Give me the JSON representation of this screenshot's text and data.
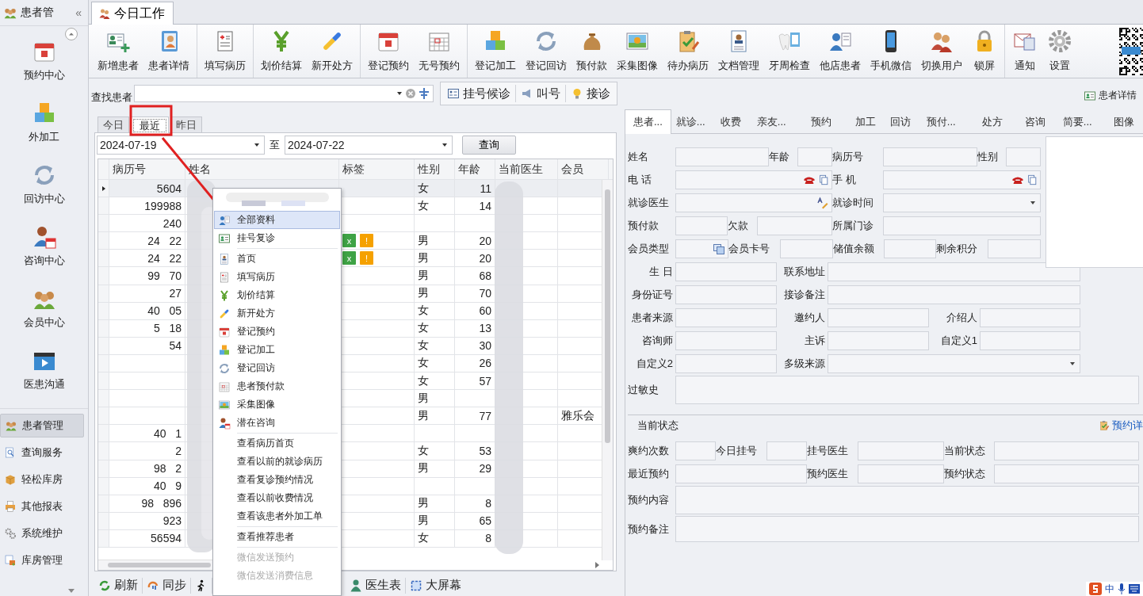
{
  "sidebar": {
    "header": "患者管",
    "collapse": "«",
    "big_items": [
      "预约中心",
      "外加工",
      "回访中心",
      "咨询中心",
      "会员中心",
      "医患沟通"
    ],
    "nav_items": [
      {
        "label": "患者管理",
        "selected": true
      },
      {
        "label": "查询服务",
        "selected": false
      },
      {
        "label": "轻松库房",
        "selected": false
      },
      {
        "label": "其他报表",
        "selected": false
      },
      {
        "label": "系统维护",
        "selected": false
      },
      {
        "label": "库房管理",
        "selected": false
      }
    ]
  },
  "document_tab": {
    "label": "今日工作"
  },
  "toolbar": {
    "groups": [
      [
        "新增患者",
        "患者详情"
      ],
      [
        "填写病历"
      ],
      [
        "划价结算",
        "新开处方"
      ],
      [
        "登记预约",
        "无号预约"
      ],
      [
        "登记加工",
        "登记回访",
        "预付款",
        "采集图像",
        "待办病历",
        "文档管理",
        "牙周检查",
        "他店患者",
        "手机微信",
        "切换用户",
        "锁屏"
      ],
      [
        "通知",
        "设置"
      ]
    ]
  },
  "search": {
    "label": "查找患者",
    "buttons": [
      "挂号候诊",
      "叫号",
      "接诊"
    ]
  },
  "detail_button": "患者详情",
  "period_tabs": [
    {
      "label": "今日",
      "selected": false
    },
    {
      "label": "最近",
      "selected": true
    },
    {
      "label": "昨日",
      "selected": false
    }
  ],
  "date_range": {
    "from": "2024-07-19",
    "separator": "至",
    "to": "2024-07-22",
    "query": "查询"
  },
  "table": {
    "columns": [
      "病历号",
      "姓名",
      "标签",
      "性别",
      "年龄",
      "当前医生",
      "会员"
    ],
    "rows": [
      {
        "selected": true,
        "id": "5604",
        "sex": "女",
        "age": "11"
      },
      {
        "selected": false,
        "id": "199988",
        "sex": "女",
        "age": "14"
      },
      {
        "selected": false,
        "id": "240"
      },
      {
        "selected": false,
        "id": "24   22",
        "tags": [
          {
            "text": "x",
            "color": "#3fa345"
          },
          {
            "text": "!",
            "color": "#f5a100"
          }
        ],
        "sex": "男",
        "age": "20"
      },
      {
        "selected": false,
        "id": "24   22",
        "tags": [
          {
            "text": "x",
            "color": "#3fa345"
          },
          {
            "text": "!",
            "color": "#f5a100"
          }
        ],
        "sex": "男",
        "age": "20"
      },
      {
        "selected": false,
        "id": "99   70",
        "sex": "男",
        "age": "68"
      },
      {
        "selected": false,
        "id": "27",
        "sex": "男",
        "age": "70"
      },
      {
        "selected": false,
        "id": "40   05",
        "sex": "女",
        "age": "60"
      },
      {
        "selected": false,
        "id": "5   18",
        "sex": "女",
        "age": "13"
      },
      {
        "selected": false,
        "id": "54",
        "sex": "女",
        "age": "30"
      },
      {
        "selected": false,
        "sex": "女",
        "age": "26"
      },
      {
        "selected": false,
        "sex": "女",
        "age": "57"
      },
      {
        "selected": false,
        "sex": "男"
      },
      {
        "selected": false,
        "sex": "男",
        "age": "77",
        "member": "雅乐会"
      },
      {
        "selected": false,
        "id": "40   1"
      },
      {
        "selected": false,
        "id": "2",
        "sex": "女",
        "age": "53"
      },
      {
        "selected": false,
        "id": "98   2",
        "sex": "男",
        "age": "29"
      },
      {
        "selected": false,
        "id": "40   9"
      },
      {
        "selected": false,
        "id": "98   896",
        "sex": "男",
        "age": "8"
      },
      {
        "selected": false,
        "id": "923",
        "sex": "男",
        "age": "65"
      },
      {
        "selected": false,
        "id": "56594",
        "sex": "女",
        "age": "8"
      }
    ]
  },
  "context_menu": {
    "items": [
      {
        "kind": "item",
        "label": "全部资料",
        "selected": true,
        "disabled": false
      },
      {
        "kind": "item",
        "label": "挂号复诊",
        "selected": false,
        "disabled": false
      },
      {
        "kind": "separator"
      },
      {
        "kind": "item",
        "label": "首页",
        "selected": false,
        "disabled": false
      },
      {
        "kind": "item",
        "label": "填写病历",
        "selected": false,
        "disabled": false
      },
      {
        "kind": "item",
        "label": "划价结算",
        "selected": false,
        "disabled": false
      },
      {
        "kind": "item",
        "label": "新开处方",
        "selected": false,
        "disabled": false
      },
      {
        "kind": "item",
        "label": "登记预约",
        "selected": false,
        "disabled": false
      },
      {
        "kind": "item",
        "label": "登记加工",
        "selected": false,
        "disabled": false
      },
      {
        "kind": "item",
        "label": "登记回访",
        "selected": false,
        "disabled": false
      },
      {
        "kind": "item",
        "label": "患者预付款",
        "selected": false,
        "disabled": false
      },
      {
        "kind": "item",
        "label": "采集图像",
        "selected": false,
        "disabled": false
      },
      {
        "kind": "item",
        "label": "潜在咨询",
        "selected": false,
        "disabled": false
      },
      {
        "kind": "separator"
      },
      {
        "kind": "item",
        "label": "查看病历首页",
        "selected": false,
        "disabled": false
      },
      {
        "kind": "item",
        "label": "查看以前的就诊病历",
        "selected": false,
        "disabled": false
      },
      {
        "kind": "item",
        "label": "查看复诊预约情况",
        "selected": false,
        "disabled": false
      },
      {
        "kind": "item",
        "label": "查看以前收费情况",
        "selected": false,
        "disabled": false
      },
      {
        "kind": "item",
        "label": "查看该患者外加工单",
        "selected": false,
        "disabled": false
      },
      {
        "kind": "separator"
      },
      {
        "kind": "item",
        "label": "查看推荐患者",
        "selected": false,
        "disabled": false
      },
      {
        "kind": "separator"
      },
      {
        "kind": "item",
        "label": "微信发送预约",
        "selected": false,
        "disabled": true
      },
      {
        "kind": "item",
        "label": "微信发送消费信息",
        "selected": false,
        "disabled": true
      }
    ]
  },
  "bottom_bar": {
    "buttons": [
      "刷新",
      "同步",
      "医生表",
      "大屏幕"
    ]
  },
  "detail_panel": {
    "tabs": [
      {
        "label": "患者...",
        "selected": true
      },
      {
        "label": "就诊...",
        "selected": false
      },
      {
        "label": "收费",
        "selected": false
      },
      {
        "label": "亲友...",
        "selected": false
      },
      {
        "label": "预约",
        "selected": false
      },
      {
        "label": "加工",
        "selected": false
      },
      {
        "label": "回访",
        "selected": false
      },
      {
        "label": "预付...",
        "selected": false
      },
      {
        "label": "处方",
        "selected": false
      },
      {
        "label": "咨询",
        "selected": false
      },
      {
        "label": "简要...",
        "selected": false
      },
      {
        "label": "图像",
        "selected": false
      }
    ],
    "field_rows": [
      [
        {
          "label": "姓名",
          "kind": "text"
        },
        {
          "label": "年龄",
          "kind": "text"
        },
        {
          "label": "病历号",
          "kind": "text"
        },
        {
          "label": "性别",
          "kind": "text"
        }
      ],
      [
        {
          "label": "电 话",
          "kind": "phone"
        },
        {
          "label": "手 机",
          "kind": "phone"
        }
      ],
      [
        {
          "label": "就诊医生",
          "kind": "pick"
        },
        {
          "label": "就诊时间",
          "kind": "dropdown"
        }
      ],
      [
        {
          "label": "预付款",
          "kind": "text"
        },
        {
          "label": "欠款",
          "kind": "text"
        },
        {
          "label": "所属门诊",
          "kind": "text"
        }
      ],
      [
        {
          "label": "会员类型",
          "kind": "card"
        },
        {
          "label": "会员卡号",
          "kind": "text"
        },
        {
          "label": "储值余额",
          "kind": "text"
        },
        {
          "label": "剩余积分",
          "kind": "text"
        }
      ],
      [
        {
          "label": "生 日",
          "kind": "text"
        },
        {
          "label": "联系地址",
          "kind": "text"
        }
      ],
      [
        {
          "label": "身份证号",
          "kind": "text"
        },
        {
          "label": "接诊备注",
          "kind": "text"
        }
      ],
      [
        {
          "label": "患者来源",
          "kind": "text"
        },
        {
          "label": "邀约人",
          "kind": "text"
        },
        {
          "label": "介绍人",
          "kind": "text"
        }
      ],
      [
        {
          "label": "咨询师",
          "kind": "text"
        },
        {
          "label": "主诉",
          "kind": "text"
        },
        {
          "label": "自定义1",
          "kind": "text"
        }
      ],
      [
        {
          "label": "自定义2",
          "kind": "text"
        },
        {
          "label": "多级来源",
          "kind": "dropdown"
        }
      ],
      [
        {
          "label": "过敏史",
          "kind": "text"
        }
      ]
    ],
    "status": {
      "title": "当前状态",
      "link": "预约详",
      "field_rows": [
        [
          {
            "label": "爽约次数",
            "kind": "text"
          },
          {
            "label": "今日挂号",
            "kind": "text"
          },
          {
            "label": "挂号医生",
            "kind": "text"
          },
          {
            "label": "当前状态",
            "kind": "text"
          }
        ],
        [
          {
            "label": "最近预约",
            "kind": "text"
          },
          {
            "label": "预约医生",
            "kind": "text"
          },
          {
            "label": "预约状态",
            "kind": "text"
          }
        ],
        [
          {
            "label": "预约内容",
            "kind": "text"
          }
        ],
        [
          {
            "label": "预约备注",
            "kind": "text"
          }
        ]
      ]
    }
  },
  "tray": {
    "input_mode": "中"
  }
}
